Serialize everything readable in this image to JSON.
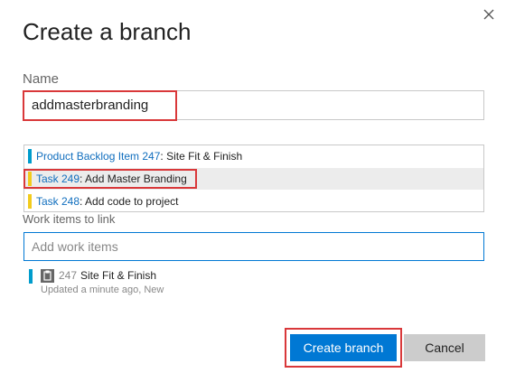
{
  "dialog": {
    "title": "Create a branch",
    "close_icon": "close-icon"
  },
  "name_field": {
    "label": "Name",
    "value": "addmasterbranding"
  },
  "suggestions": [
    {
      "type": "Product Backlog Item 247",
      "title": "Site Fit & Finish",
      "color": "#009ccc",
      "selected": false
    },
    {
      "type": "Task 249",
      "title": "Add Master Branding",
      "color": "#f2cb1d",
      "selected": true
    },
    {
      "type": "Task 248",
      "title": "Add code to project",
      "color": "#f2cb1d",
      "selected": false
    }
  ],
  "work_items": {
    "label": "Work items to link",
    "placeholder": "Add work items"
  },
  "linked_item": {
    "id": "247",
    "title": "Site Fit & Finish",
    "meta": "Updated a minute ago, New",
    "icon": "backlog-item-icon",
    "color": "#009ccc"
  },
  "buttons": {
    "create": "Create branch",
    "cancel": "Cancel"
  },
  "colors": {
    "accent": "#0078d4",
    "highlight": "#d9383a",
    "link": "#106ebe"
  },
  "sep": ": "
}
